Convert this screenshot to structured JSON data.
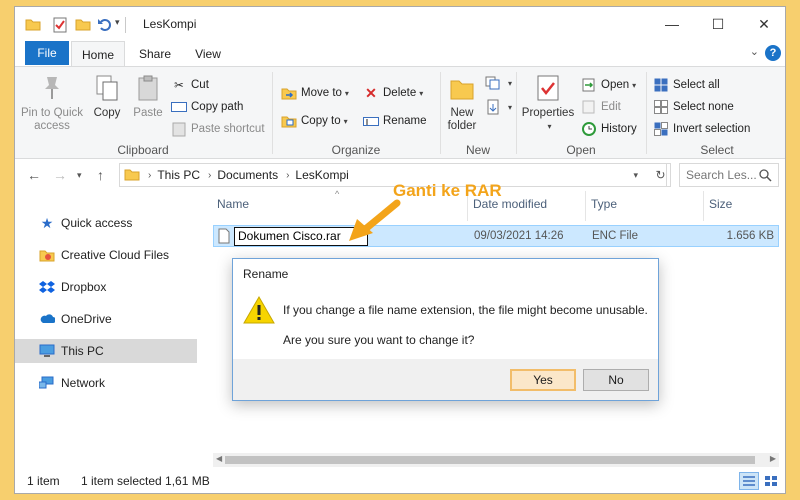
{
  "window": {
    "title": "LesKompi"
  },
  "ribbon_tabs": {
    "file": "File",
    "home": "Home",
    "share": "Share",
    "view": "View"
  },
  "clipboard": {
    "label": "Clipboard",
    "pin": "Pin to Quick access",
    "copy": "Copy",
    "paste": "Paste",
    "cut": "Cut",
    "copy_path": "Copy path",
    "paste_shortcut": "Paste shortcut"
  },
  "organize": {
    "label": "Organize",
    "move_to": "Move to",
    "copy_to": "Copy to",
    "delete": "Delete",
    "rename": "Rename"
  },
  "new_group": {
    "label": "New",
    "new_folder": "New folder"
  },
  "open_group": {
    "label": "Open",
    "properties": "Properties",
    "open": "Open",
    "edit": "Edit",
    "history": "History"
  },
  "select_group": {
    "label": "Select",
    "select_all": "Select all",
    "select_none": "Select none",
    "invert": "Invert selection"
  },
  "address": {
    "crumbs": [
      "This PC",
      "Documents",
      "LesKompi"
    ],
    "search_placeholder": "Search Les..."
  },
  "nav_pane": [
    {
      "label": "Quick access"
    },
    {
      "label": "Creative Cloud Files"
    },
    {
      "label": "Dropbox"
    },
    {
      "label": "OneDrive"
    },
    {
      "label": "This PC"
    },
    {
      "label": "Network"
    }
  ],
  "columns": {
    "name": "Name",
    "date": "Date modified",
    "type": "Type",
    "size": "Size"
  },
  "file": {
    "name_editing": "Dokumen Cisco.rar",
    "date": "09/03/2021 14:26",
    "type": "ENC File",
    "size": "1.656 KB"
  },
  "annotation": "Ganti ke RAR",
  "dialog": {
    "title": "Rename",
    "line1": "If you change a file name extension, the file might become unusable.",
    "line2": "Are you sure you want to change it?",
    "yes": "Yes",
    "no": "No"
  },
  "status": {
    "count": "1 item",
    "selected": "1 item selected  1,61 MB"
  },
  "colors": {
    "accent": "#1a73c8",
    "background": "#f7cf6e",
    "annotation": "#f3a41a"
  }
}
